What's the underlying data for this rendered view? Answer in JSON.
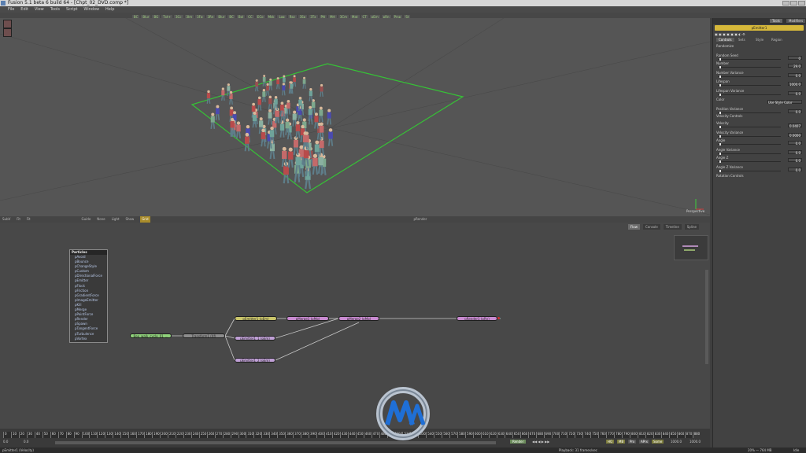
{
  "window": {
    "title": "Fusion 5.1 beta 6 build 64 - [Chpt_02_DVD.comp *]"
  },
  "menu": [
    "File",
    "Edit",
    "View",
    "Tools",
    "Script",
    "Window",
    "Help"
  ],
  "toolbar": [
    "BC",
    "Blur",
    "BG",
    "Txt+",
    "3Cc",
    "3Im",
    "3Fg",
    "3Rn",
    "Blur",
    "BC",
    "Bol",
    "CC",
    "ECo",
    "Msk",
    "Log",
    "Rsz",
    "3Sp",
    "3Tx",
    "Ptt",
    "Mrt",
    "3Cm",
    "Mat",
    "CT",
    "pEm",
    "pRn",
    "Prsp",
    "St"
  ],
  "viewer": {
    "label_bottom_right": "Perspective"
  },
  "viewer_bar": [
    "SubV",
    "Fit",
    "Fit",
    "Guide",
    "None",
    "Light",
    "Show",
    "Grid"
  ],
  "viewer_bar_center": "pRender",
  "flow": {
    "tabs": [
      "Flow",
      "Console",
      "Timeline",
      "Spline"
    ],
    "particles_menu": {
      "title": "Particles",
      "items": [
        "pAvoid",
        "pBounce",
        "pChangeStyle",
        "pCustom",
        "pDirectionalForce",
        "pEmitter",
        "pFlock",
        "pFriction",
        "pGradientForce",
        "pImageEmitter",
        "pKill",
        "pMerge",
        "pPointForce",
        "pRender",
        "pSpawn",
        "pTangentForce",
        "pTurbulence",
        "pVortex"
      ]
    },
    "nodes": [
      {
        "id": "walk",
        "label": "Bee_walk_cycle_01_...",
        "color": "#8fd17a"
      },
      {
        "id": "transform",
        "label": "Transform1 (Xf)",
        "color": "#8c8c8c"
      },
      {
        "id": "pemitter1",
        "label": "pEmitter1 (pEm)",
        "color": "#c9c46a"
      },
      {
        "id": "pemitter1_1",
        "label": "pEmitter1_1 (pEm)",
        "color": "#c0a0d6"
      },
      {
        "id": "pemitter1_2",
        "label": "pEmitter1_2 (pEm)",
        "color": "#c0a0d6"
      },
      {
        "id": "pmerge1",
        "label": "pMerge1 (pMg)",
        "color": "#c88ad0"
      },
      {
        "id": "pmerge2",
        "label": "pMerge2 (pMg)",
        "color": "#c88ad0"
      },
      {
        "id": "prender",
        "label": "pRender1 (pRn)",
        "color": "#c88ad0"
      }
    ]
  },
  "timeline": {
    "ticks": [
      "0",
      "10",
      "20",
      "30",
      "40",
      "50",
      "60",
      "70",
      "80",
      "90",
      "100",
      "110",
      "120",
      "130",
      "140",
      "150",
      "160",
      "170",
      "180",
      "190",
      "200",
      "210",
      "220",
      "230",
      "240",
      "250",
      "260",
      "270",
      "280",
      "290",
      "300",
      "310",
      "320",
      "330",
      "340",
      "350",
      "360",
      "370",
      "380",
      "390",
      "400",
      "410",
      "420",
      "430",
      "440",
      "450",
      "460",
      "470",
      "480",
      "490",
      "500",
      "510",
      "520",
      "530",
      "540",
      "550",
      "560",
      "570",
      "580",
      "590",
      "600",
      "610",
      "620",
      "630",
      "640",
      "650",
      "660",
      "670",
      "680",
      "690",
      "700",
      "710",
      "720",
      "730",
      "740",
      "750",
      "760",
      "770",
      "780",
      "790",
      "800",
      "810",
      "820",
      "830",
      "840",
      "850",
      "860",
      "870",
      "880"
    ],
    "start": "0.0",
    "current": "0.0",
    "end": "1000.0",
    "render_button": "Render",
    "toggles": [
      "HQ",
      "MB",
      "Prx",
      "APrx",
      "Some"
    ],
    "end_field": "1000.0"
  },
  "status": {
    "left": "pEmitter1 (Velocity)",
    "center": "Playback: 31 frames/sec",
    "right": "20% — 764 MB",
    "idle": "Idle"
  },
  "panel": {
    "tabs": [
      "Tools",
      "Modifiers"
    ],
    "tool_name": "pEmitter1",
    "subtabs": [
      "Controls",
      "Sets",
      "Style",
      "Region"
    ],
    "fields": [
      {
        "label": "Randomize",
        "value": ""
      },
      {
        "label": "Random Seed",
        "value": "0"
      },
      {
        "label": "Number",
        "value": "29.0"
      },
      {
        "label": "Number Variance",
        "value": "0.0"
      },
      {
        "label": "Lifespan",
        "value": "1000.0"
      },
      {
        "label": "Lifespan Variance",
        "value": "0.0"
      },
      {
        "label": "Color",
        "value": "Use Style Color"
      },
      {
        "label": "Position Variance",
        "value": "0.0"
      },
      {
        "label": "Velocity Controls",
        "value": ""
      },
      {
        "label": "Velocity",
        "value": "0.0407"
      },
      {
        "label": "Velocity Variance",
        "value": "0.0000"
      },
      {
        "label": "Angle",
        "value": "0.0"
      },
      {
        "label": "Angle Variance",
        "value": "0.0"
      },
      {
        "label": "Angle Z",
        "value": "0.0"
      },
      {
        "label": "Angle Z Variance",
        "value": "0.0"
      },
      {
        "label": "Rotation Controls",
        "value": ""
      }
    ]
  },
  "colors": {
    "accent": "#d6b83a",
    "grid": "#2bd12b",
    "viewerBg": "#555555",
    "flowBg": "#484848"
  }
}
